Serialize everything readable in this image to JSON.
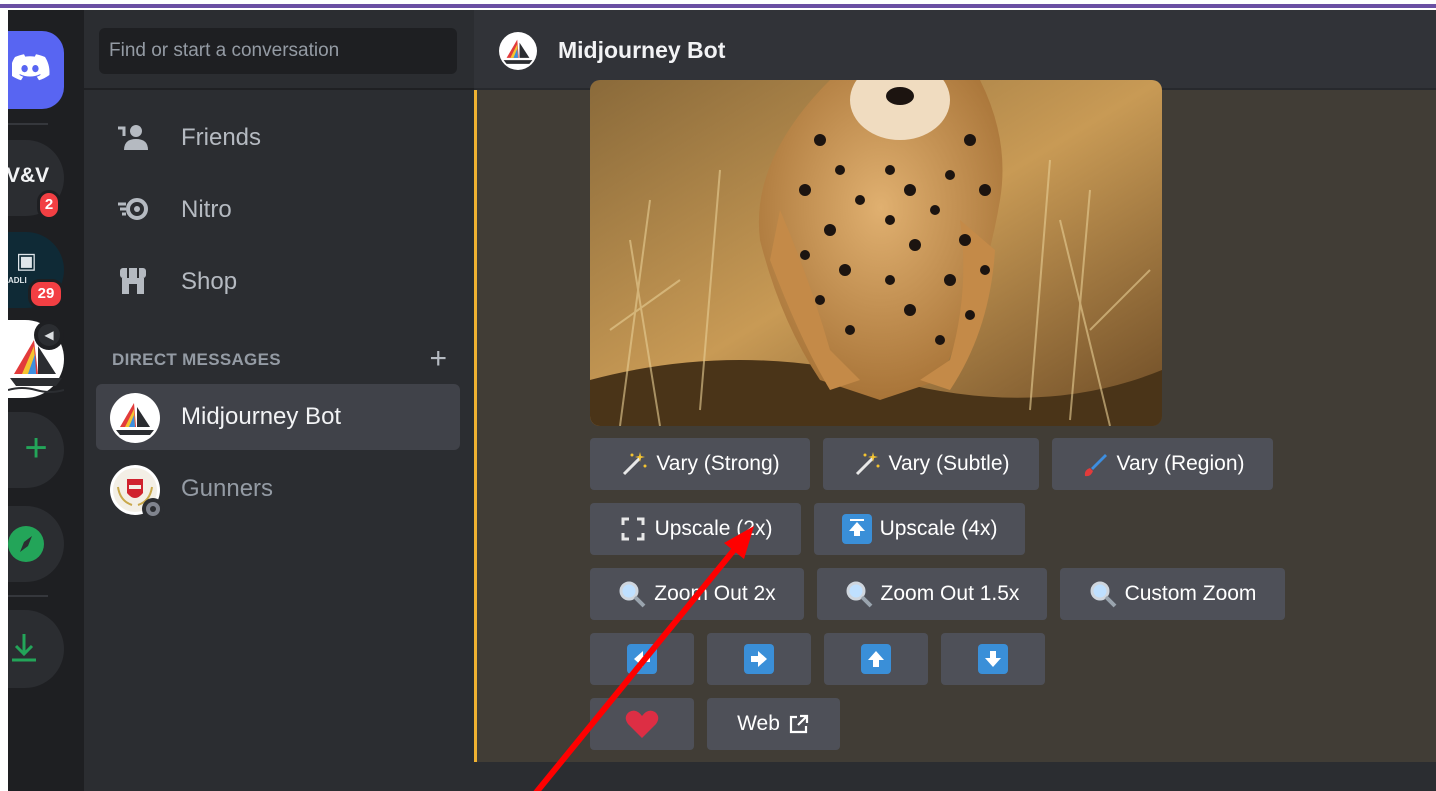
{
  "server_rail": {
    "vv_label": "V&V",
    "vv_badge": "2",
    "tv_text": "ADLI",
    "tv_badge": "29"
  },
  "sidebar": {
    "search_placeholder": "Find or start a conversation",
    "nav": [
      {
        "label": "Friends",
        "icon": "friends-icon"
      },
      {
        "label": "Nitro",
        "icon": "nitro-icon"
      },
      {
        "label": "Shop",
        "icon": "shop-icon"
      }
    ],
    "dm_header": "DIRECT MESSAGES",
    "dms": [
      {
        "label": "Midjourney Bot",
        "active": true
      },
      {
        "label": "Gunners",
        "active": false
      }
    ]
  },
  "channel": {
    "title": "Midjourney Bot"
  },
  "buttons": {
    "row1": [
      {
        "label": "Vary (Strong)",
        "icon": "magic-wand-icon"
      },
      {
        "label": "Vary (Subtle)",
        "icon": "magic-wand-icon"
      },
      {
        "label": "Vary (Region)",
        "icon": "paintbrush-icon"
      }
    ],
    "row2": [
      {
        "label": "Upscale (2x)",
        "icon": "expand-icon"
      },
      {
        "label": "Upscale (4x)",
        "icon": "arrow-up-bar-icon"
      }
    ],
    "row3": [
      {
        "label": "Zoom Out 2x",
        "icon": "magnifier-icon"
      },
      {
        "label": "Zoom Out 1.5x",
        "icon": "magnifier-icon"
      },
      {
        "label": "Custom Zoom",
        "icon": "magnifier-icon"
      }
    ],
    "row4": [
      {
        "icon": "arrow-left-icon"
      },
      {
        "icon": "arrow-right-icon"
      },
      {
        "icon": "arrow-up-icon"
      },
      {
        "icon": "arrow-down-icon"
      }
    ],
    "row5": [
      {
        "icon": "heart-icon"
      },
      {
        "label": "Web",
        "icon": "external-link-icon"
      }
    ]
  },
  "colors": {
    "blurple": "#5865f2",
    "green": "#23a559",
    "red": "#f23f43",
    "button_bg": "#4e5058",
    "annotation_arrow": "#ff0000"
  }
}
